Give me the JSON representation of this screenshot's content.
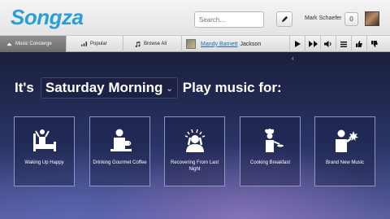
{
  "header": {
    "logo": "Songza",
    "search_placeholder": "Search...",
    "username": "Mark Schaefer",
    "notification_count": "0"
  },
  "nav": {
    "items": [
      {
        "label": "Music Concierge",
        "active": true
      },
      {
        "label": "Popular",
        "active": false
      },
      {
        "label": "Browse All",
        "active": false
      }
    ],
    "now_playing": {
      "artist": "Mandy Barnett",
      "title": "Jackson"
    }
  },
  "main": {
    "prefix": "It's",
    "time_of_day": "Saturday Morning",
    "suffix": "Play music for:",
    "activities": [
      {
        "label": "Waking Up Happy",
        "icon": "person-in-bed-icon"
      },
      {
        "label": "Drinking Gourmet Coffee",
        "icon": "coffee-drinker-icon"
      },
      {
        "label": "Recovering From Last Night",
        "icon": "headache-person-icon"
      },
      {
        "label": "Cooking Breakfast",
        "icon": "chef-icon"
      },
      {
        "label": "Brand New Music",
        "icon": "new-music-person-icon"
      }
    ]
  }
}
